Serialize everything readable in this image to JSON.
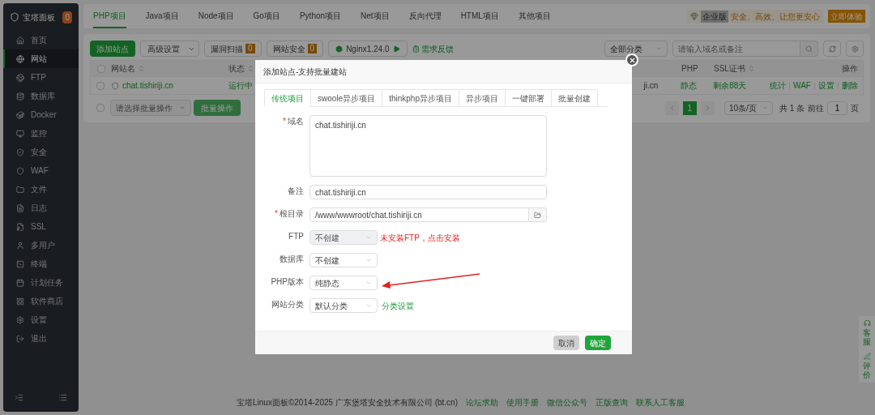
{
  "sidebar": {
    "brand": "宝塔面板",
    "badge": "0",
    "items": [
      {
        "label": "首页",
        "selected": false
      },
      {
        "label": "网站",
        "selected": true
      },
      {
        "label": "FTP",
        "selected": false
      },
      {
        "label": "数据库",
        "selected": false
      },
      {
        "label": "Docker",
        "selected": false
      },
      {
        "label": "监控",
        "selected": false
      },
      {
        "label": "安全",
        "selected": false
      },
      {
        "label": "WAF",
        "selected": false
      },
      {
        "label": "文件",
        "selected": false
      },
      {
        "label": "日志",
        "selected": false
      },
      {
        "label": "SSL",
        "selected": false
      },
      {
        "label": "多用户",
        "selected": false
      },
      {
        "label": "终端",
        "selected": false
      },
      {
        "label": "计划任务",
        "selected": false
      },
      {
        "label": "软件商店",
        "selected": false
      },
      {
        "label": "设置",
        "selected": false
      },
      {
        "label": "退出",
        "selected": false
      }
    ]
  },
  "top_tabs": [
    {
      "label": "PHP项目",
      "selected": true
    },
    {
      "label": "Java项目",
      "selected": false
    },
    {
      "label": "Node项目",
      "selected": false
    },
    {
      "label": "Go项目",
      "selected": false
    },
    {
      "label": "Python项目",
      "selected": false
    },
    {
      "label": "Net项目",
      "selected": false
    },
    {
      "label": "反向代理",
      "selected": false
    },
    {
      "label": "HTML项目",
      "selected": false
    },
    {
      "label": "其他项目",
      "selected": false
    }
  ],
  "promo": {
    "edition": "企业版",
    "slogan": "安全、高效、让您更安心",
    "button": "立即体验"
  },
  "toolbar": {
    "buttons": [
      {
        "kind": "primary",
        "label": "添加站点"
      },
      {
        "kind": "dropdown",
        "label": "高级设置"
      },
      {
        "kind": "count",
        "label": "漏洞扫描",
        "badge": "0"
      },
      {
        "kind": "count",
        "label": "网站安全",
        "badge": "0"
      },
      {
        "kind": "server",
        "label": "Nginx1.24.0"
      },
      {
        "kind": "link",
        "label": "需求反馈"
      }
    ],
    "category": "全部分类",
    "search_placeholder": "请输入域名或备注"
  },
  "table": {
    "select_all_checked": false,
    "columns": [
      {
        "label": "网站名",
        "sortable": true
      },
      {
        "label": "状态",
        "sortable": true
      },
      {
        "label": "PHP",
        "sortable": false
      },
      {
        "label": "SSL证书",
        "sortable": true
      },
      {
        "label": "操作",
        "sortable": false
      }
    ],
    "rows": [
      {
        "checked": false,
        "name": "chat.tishiriji.cn",
        "status": "运行中",
        "column_3": "ji.cn",
        "php": "静态",
        "ssl": "剩余88天",
        "actions": [
          "统计",
          "WAF",
          "设置",
          "删除"
        ]
      }
    ]
  },
  "batch": {
    "checked": false,
    "placeholder": "请选择批量操作",
    "button": "批量操作"
  },
  "pagination": {
    "pages": [
      {
        "label": "1",
        "selected": true
      }
    ],
    "page_size": "10条/页",
    "total": "共 1 条",
    "goto": "前往",
    "goto_value": "1",
    "page_unit": "页"
  },
  "footer": {
    "copyright": "宝塔Linux面板©2014-2025 广东堡塔安全技术有限公司 (bt.cn)",
    "links": [
      "论坛求助",
      "使用手册",
      "微信公众号",
      "正版查询",
      "联系人工客服"
    ]
  },
  "side_widget": [
    {
      "label": "客服"
    },
    {
      "label": "评价"
    }
  ],
  "dialog": {
    "title": "添加站点-支持批量建站",
    "required_mark": "*",
    "tabs": [
      {
        "label": "传统项目",
        "selected": true
      },
      {
        "label": "swoole异步项目",
        "selected": false
      },
      {
        "label": "thinkphp异步项目",
        "selected": false
      },
      {
        "label": "异步项目",
        "selected": false
      },
      {
        "label": "一键部署",
        "selected": false
      },
      {
        "label": "批量创建",
        "selected": false
      }
    ],
    "fields": [
      {
        "kind": "textarea",
        "label": "域名",
        "required": true,
        "value": "chat.tishiriji.cn"
      },
      {
        "kind": "input",
        "label": "备注",
        "required": false,
        "value": "chat.tishiriji.cn"
      },
      {
        "kind": "path",
        "label": "根目录",
        "required": true,
        "value": "/www/wwwroot/chat.tishiriji.cn"
      },
      {
        "kind": "select",
        "label": "FTP",
        "required": false,
        "value": "不创建",
        "disabled": true,
        "warning": "未安装FTP，点击安装"
      },
      {
        "kind": "select",
        "label": "数据库",
        "required": false,
        "value": "不创建",
        "disabled": false
      },
      {
        "kind": "select",
        "label": "PHP版本",
        "required": false,
        "value": "纯静态",
        "disabled": false
      },
      {
        "kind": "select",
        "label": "网站分类",
        "required": false,
        "value": "默认分类",
        "disabled": false,
        "link": "分类设置"
      }
    ],
    "buttons": [
      {
        "kind": "cancel",
        "label": "取消",
        "disabled": true
      },
      {
        "kind": "confirm",
        "label": "确定",
        "disabled": false
      }
    ]
  }
}
